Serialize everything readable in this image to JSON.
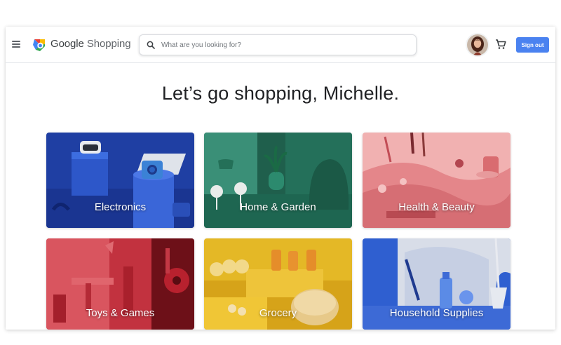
{
  "header": {
    "logo_text_bold": "Google",
    "logo_text_rest": " Shopping",
    "search_placeholder": "What are you looking for?",
    "signout_label": "Sign out"
  },
  "greeting": "Let’s go shopping, Michelle.",
  "categories": [
    {
      "label": "Electronics"
    },
    {
      "label": "Home & Garden"
    },
    {
      "label": "Health & Beauty"
    },
    {
      "label": "Toys & Games"
    },
    {
      "label": "Grocery"
    },
    {
      "label": "Household Supplies"
    }
  ],
  "icons": {
    "menu": "menu-icon",
    "logo": "google-shopping-logo-icon",
    "search": "search-icon",
    "cart": "cart-icon"
  },
  "colors": {
    "signout_button": "#4a82f0",
    "electronics_tile": "#1f3fa3",
    "home_garden_tile": "#2b7a63",
    "health_beauty_tile": "#e4868a",
    "toys_games_tile": "#c2323f",
    "grocery_tile": "#e4b826",
    "household_tile": "#3d6ad6"
  }
}
